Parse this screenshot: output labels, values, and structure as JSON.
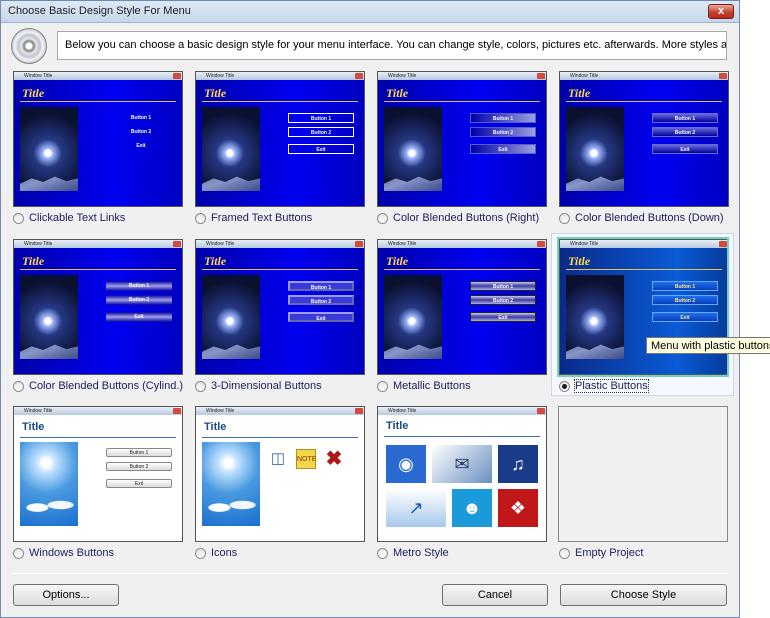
{
  "window": {
    "title": "Choose Basic Design Style For Menu",
    "close": "x"
  },
  "header": {
    "description": "Below you can choose a basic design style for your menu interface. You can change style, colors, pictures etc. afterwards. More styles are available in the editor."
  },
  "preview": {
    "window_title": "Window Title",
    "title": "Title",
    "buttons": [
      "Button 1",
      "Button 2",
      "Exit"
    ]
  },
  "styles": [
    {
      "label": "Clickable Text Links",
      "selected": false
    },
    {
      "label": "Framed Text Buttons",
      "selected": false
    },
    {
      "label": "Color Blended Buttons (Right)",
      "selected": false
    },
    {
      "label": "Color Blended Buttons (Down)",
      "selected": false
    },
    {
      "label": "Color Blended Buttons (Cylind.)",
      "selected": false
    },
    {
      "label": "3-Dimensional Buttons",
      "selected": false
    },
    {
      "label": "Metallic Buttons",
      "selected": false
    },
    {
      "label": "Plastic Buttons",
      "selected": true
    },
    {
      "label": "Windows Buttons",
      "selected": false
    },
    {
      "label": "Icons",
      "selected": false
    },
    {
      "label": "Metro Style",
      "selected": false
    },
    {
      "label": "Empty Project",
      "selected": false
    }
  ],
  "tooltip": "Menu with plastic buttons",
  "buttons": {
    "options": "Options...",
    "cancel": "Cancel",
    "choose": "Choose Style"
  },
  "colors": {
    "preview_blue": "#0000e0",
    "title_gold": "#ffd84a",
    "selection_border": "#6fd0c8"
  }
}
